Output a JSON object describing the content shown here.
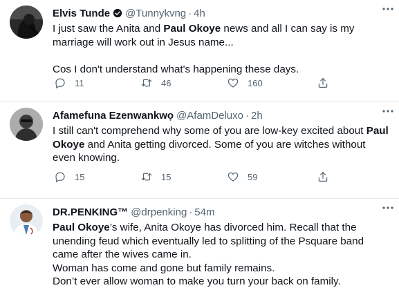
{
  "tweets": [
    {
      "name": "Elvis Tunde",
      "verified": true,
      "handle": "@Tunnykvng",
      "time": "4h",
      "p1a": "I just saw the Anita and ",
      "p1b": "Paul Okoye",
      "p1c": " news and all I can say is my marriage will work out in Jesus name...",
      "p2": "Cos I don't understand what's happening these days.",
      "replies": "11",
      "retweets": "46",
      "likes": "160"
    },
    {
      "name": "Afamefuna Ezenwankwọ",
      "verified": false,
      "handle": "@AfamDeluxo",
      "time": "2h",
      "p1a": "I still can't comprehend why some of you are low-key excited about ",
      "p1b": "Paul Okoye",
      "p1c": " and Anita getting divorced. Some of you are witches without even knowing.",
      "replies": "15",
      "retweets": "15",
      "likes": "59"
    },
    {
      "name": "DR.PENKING™",
      "verified": false,
      "handle": "@drpenking",
      "time": "54m",
      "p1b": "Paul Okoye",
      "p1c": "’s wife, Anita Okoye has divorced him. Recall that the unending feud which eventually led to splitting of the Psquare band came after the wives came in.",
      "p2": "Woman has come and gone but family remains.",
      "p3": "Don’t ever allow woman to make you turn your back on family."
    }
  ],
  "separator": "·",
  "colors": {
    "text": "#0f1419",
    "secondary": "#536471",
    "divider": "#e3e8ec",
    "verified": "#1d9bf0"
  }
}
